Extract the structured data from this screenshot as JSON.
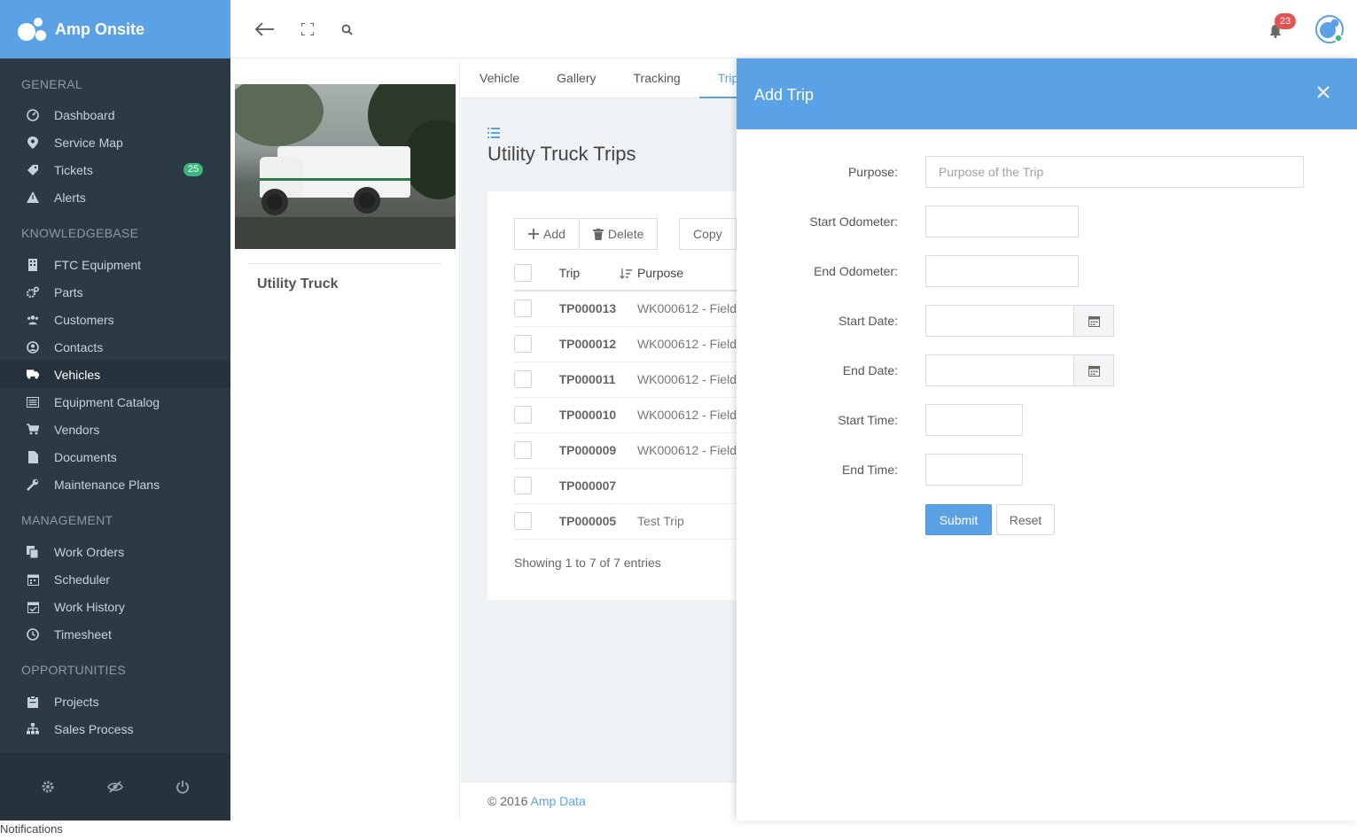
{
  "app": {
    "title": "Amp Onsite"
  },
  "sidebar": {
    "sections": [
      {
        "title": "GENERAL",
        "items": [
          {
            "label": "Dashboard",
            "icon": "dashboard-icon"
          },
          {
            "label": "Service Map",
            "icon": "map-pin-icon"
          },
          {
            "label": "Tickets",
            "icon": "tag-icon",
            "badge": "25"
          },
          {
            "label": "Alerts",
            "icon": "warning-icon"
          }
        ]
      },
      {
        "title": "KNOWLEDGEBASE",
        "items": [
          {
            "label": "FTC Equipment",
            "icon": "building-icon"
          },
          {
            "label": "Parts",
            "icon": "cogs-icon"
          },
          {
            "label": "Customers",
            "icon": "users-icon"
          },
          {
            "label": "Contacts",
            "icon": "user-circle-icon"
          },
          {
            "label": "Vehicles",
            "icon": "truck-icon",
            "active": true
          },
          {
            "label": "Equipment Catalog",
            "icon": "list-alt-icon"
          },
          {
            "label": "Vendors",
            "icon": "cart-icon"
          },
          {
            "label": "Documents",
            "icon": "file-icon"
          },
          {
            "label": "Maintenance Plans",
            "icon": "wrench-icon"
          }
        ]
      },
      {
        "title": "MANAGEMENT",
        "items": [
          {
            "label": "Work Orders",
            "icon": "copy-icon"
          },
          {
            "label": "Scheduler",
            "icon": "calendar-icon"
          },
          {
            "label": "Work History",
            "icon": "calendar-check-icon"
          },
          {
            "label": "Timesheet",
            "icon": "clock-icon"
          }
        ]
      },
      {
        "title": "OPPORTUNITIES",
        "items": [
          {
            "label": "Projects",
            "icon": "clipboard-icon"
          },
          {
            "label": "Sales Process",
            "icon": "sitemap-icon"
          }
        ]
      }
    ],
    "footer": [
      "settings-icon",
      "eye-slash-icon",
      "power-icon"
    ]
  },
  "topbar": {
    "notification_count": "23"
  },
  "vehicle": {
    "name": "Utility Truck"
  },
  "tabs": [
    {
      "label": "Vehicle"
    },
    {
      "label": "Gallery"
    },
    {
      "label": "Tracking"
    },
    {
      "label": "Trips",
      "active": true
    }
  ],
  "page": {
    "title": "Utility Truck Trips"
  },
  "toolbar": {
    "add_label": "Add",
    "delete_label": "Delete",
    "copy_label": "Copy"
  },
  "table": {
    "columns": [
      "Trip",
      "Purpose"
    ],
    "rows": [
      {
        "trip": "TP000013",
        "purpose": "WK000612 - Field"
      },
      {
        "trip": "TP000012",
        "purpose": "WK000612 - Field"
      },
      {
        "trip": "TP000011",
        "purpose": "WK000612 - Field"
      },
      {
        "trip": "TP000010",
        "purpose": "WK000612 - Field"
      },
      {
        "trip": "TP000009",
        "purpose": "WK000612 - Field"
      },
      {
        "trip": "TP000007",
        "purpose": ""
      },
      {
        "trip": "TP000005",
        "purpose": "Test Trip"
      }
    ],
    "info": "Showing 1 to 7 of 7 entries"
  },
  "footer": {
    "copyright": "© 2016",
    "link": "Amp Data"
  },
  "modal": {
    "title": "Add Trip",
    "fields": {
      "purpose": {
        "label": "Purpose:",
        "placeholder": "Purpose of the Trip",
        "value": ""
      },
      "start_odometer": {
        "label": "Start Odometer:",
        "value": ""
      },
      "end_odometer": {
        "label": "End Odometer:",
        "value": ""
      },
      "start_date": {
        "label": "Start Date:",
        "value": ""
      },
      "end_date": {
        "label": "End Date:",
        "value": ""
      },
      "start_time": {
        "label": "Start Time:",
        "value": ""
      },
      "end_time": {
        "label": "End Time:",
        "value": ""
      }
    },
    "submit_label": "Submit",
    "reset_label": "Reset"
  },
  "status_bar": {
    "text": "Notifications"
  },
  "colors": {
    "primary": "#5aa1e6",
    "sidebar": "#2c3a45",
    "badge_green": "#3bb77e",
    "badge_red": "#e45353"
  }
}
